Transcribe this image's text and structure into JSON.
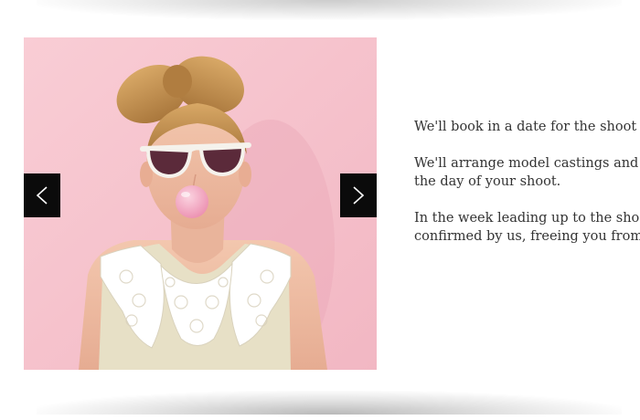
{
  "slider": {
    "image_alt": "Model blowing a pink bubblegum bubble",
    "prev_icon": "chevron-left-icon",
    "next_icon": "chevron-right-icon"
  },
  "copy": {
    "p1_l1": "We'll book in a date for the shoot a",
    "p2_l1": "We'll arrange model castings and",
    "p2_l2": "the day of your shoot.",
    "p3_l1": "In the week leading up to the shoo",
    "p3_l2": "confirmed by us, freeing you from"
  },
  "colors": {
    "slide_background": "#f6c6cf",
    "nav_button": "#0b0b0b",
    "text": "#333333"
  }
}
